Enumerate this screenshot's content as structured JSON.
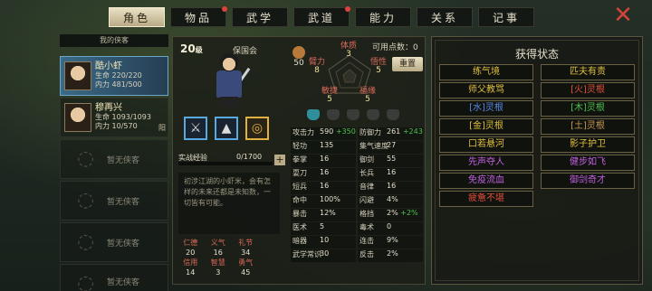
{
  "tabs": [
    {
      "label": "角色",
      "active": true,
      "dot": false
    },
    {
      "label": "物品",
      "active": false,
      "dot": true
    },
    {
      "label": "武学",
      "active": false,
      "dot": false
    },
    {
      "label": "武道",
      "active": false,
      "dot": true
    },
    {
      "label": "能力",
      "active": false,
      "dot": false
    },
    {
      "label": "关系",
      "active": false,
      "dot": false
    },
    {
      "label": "记事",
      "active": false,
      "dot": false
    }
  ],
  "close_icon": "close-x-icon",
  "sidebar": {
    "heading": "我的侠客",
    "characters": [
      {
        "name": "酷小虾",
        "hp": "生命 220/220",
        "mp": "内力 481/500",
        "side": ""
      },
      {
        "name": "穆再兴",
        "hp": "生命 1093/1093",
        "mp": "内力 10/570",
        "side": "阳"
      }
    ],
    "empty_label": "暂无侠客"
  },
  "main": {
    "level": "20",
    "level_suffix": "级",
    "faction": "保国会",
    "points_label": "可用点数：",
    "points_value": "0",
    "morality": "50",
    "reset_label": "重置",
    "attributes": {
      "physique": {
        "label": "体质",
        "value": "3"
      },
      "arm": {
        "label": "臂力",
        "value": "8"
      },
      "insight": {
        "label": "悟性",
        "value": "5"
      },
      "agility": {
        "label": "敏捷",
        "value": "5"
      },
      "root": {
        "label": "福缘",
        "value": "5"
      }
    },
    "exp_label": "实战经验",
    "exp_value": "0/1700",
    "exp_progress": 0,
    "description": "初涉江湖的小虾米，会有怎样的未来还都是未知数，一切皆有可能。",
    "virtues": [
      {
        "label": "仁德",
        "value": "20"
      },
      {
        "label": "义气",
        "value": "16"
      },
      {
        "label": "礼节",
        "value": "34"
      },
      {
        "label": "信用",
        "value": "14"
      },
      {
        "label": "智慧",
        "value": "3"
      },
      {
        "label": "勇气",
        "value": "45"
      }
    ],
    "stats": [
      {
        "k": "攻击力",
        "v": "590",
        "b": "+350"
      },
      {
        "k": "防御力",
        "v": "261",
        "b": "+243"
      },
      {
        "k": "轻功",
        "v": "135",
        "b": ""
      },
      {
        "k": "集气速度",
        "v": "27",
        "b": ""
      },
      {
        "k": "拳掌",
        "v": "16",
        "b": ""
      },
      {
        "k": "御剑",
        "v": "55",
        "b": ""
      },
      {
        "k": "耍刀",
        "v": "16",
        "b": ""
      },
      {
        "k": "长兵",
        "v": "16",
        "b": ""
      },
      {
        "k": "短兵",
        "v": "16",
        "b": ""
      },
      {
        "k": "音律",
        "v": "16",
        "b": ""
      },
      {
        "k": "命中",
        "v": "100%",
        "b": ""
      },
      {
        "k": "闪避",
        "v": "4%",
        "b": ""
      },
      {
        "k": "暴击",
        "v": "12%",
        "b": ""
      },
      {
        "k": "格挡",
        "v": "2%",
        "b": "+2%"
      },
      {
        "k": "医术",
        "v": "5",
        "b": ""
      },
      {
        "k": "毒术",
        "v": "0",
        "b": ""
      },
      {
        "k": "暗器",
        "v": "10",
        "b": ""
      },
      {
        "k": "连击",
        "v": "9%",
        "b": ""
      },
      {
        "k": "武学常识",
        "v": "30",
        "b": ""
      },
      {
        "k": "反击",
        "v": "2%",
        "b": ""
      }
    ]
  },
  "states_panel": {
    "title": "获得状态",
    "items": [
      {
        "label": "练气境",
        "color": "#e0c040"
      },
      {
        "label": "匹夫有责",
        "color": "#e0c040"
      },
      {
        "label": "师父教骂",
        "color": "#e0c040"
      },
      {
        "label": "[火]灵根",
        "color": "#e0503a"
      },
      {
        "label": "[水]灵根",
        "color": "#5a8ae8"
      },
      {
        "label": "[木]灵根",
        "color": "#4ec24e"
      },
      {
        "label": "[金]灵根",
        "color": "#e0c040"
      },
      {
        "label": "[土]灵根",
        "color": "#c89a50"
      },
      {
        "label": "口若悬河",
        "color": "#e0c040"
      },
      {
        "label": "影子护卫",
        "color": "#e0c040"
      },
      {
        "label": "先声夺人",
        "color": "#c060e0"
      },
      {
        "label": "健步如飞",
        "color": "#c060e0"
      },
      {
        "label": "免疫流血",
        "color": "#c060e0"
      },
      {
        "label": "御剑奇才",
        "color": "#c060e0"
      },
      {
        "label": "疲惫不堪",
        "color": "#e0503a"
      }
    ]
  }
}
